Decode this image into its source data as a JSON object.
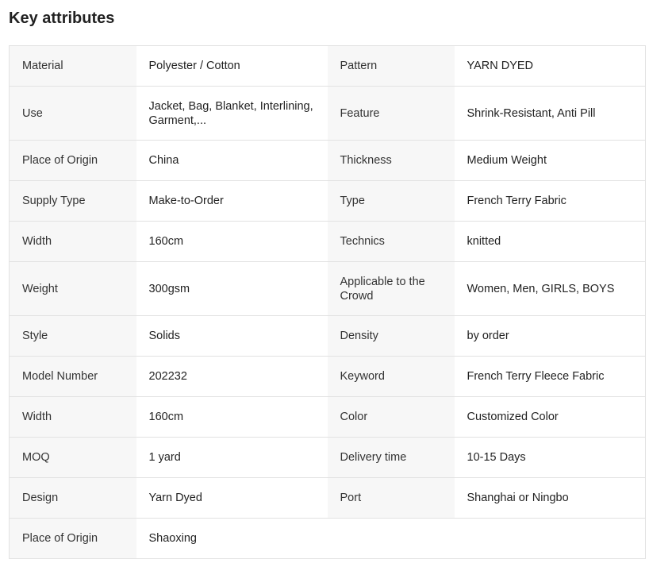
{
  "title": "Key attributes",
  "rows": [
    {
      "k1": "Material",
      "v1": "Polyester / Cotton",
      "k2": "Pattern",
      "v2": "YARN DYED"
    },
    {
      "k1": "Use",
      "v1": "Jacket, Bag, Blanket, Interlining, Garment,...",
      "k2": "Feature",
      "v2": "Shrink-Resistant, Anti Pill"
    },
    {
      "k1": "Place of Origin",
      "v1": "China",
      "k2": "Thickness",
      "v2": "Medium Weight"
    },
    {
      "k1": "Supply Type",
      "v1": "Make-to-Order",
      "k2": "Type",
      "v2": "French Terry Fabric"
    },
    {
      "k1": "Width",
      "v1": "160cm",
      "k2": "Technics",
      "v2": "knitted"
    },
    {
      "k1": "Weight",
      "v1": "300gsm",
      "k2": "Applicable to the Crowd",
      "v2": "Women, Men, GIRLS, BOYS"
    },
    {
      "k1": "Style",
      "v1": "Solids",
      "k2": "Density",
      "v2": "by order"
    },
    {
      "k1": "Model Number",
      "v1": "202232",
      "k2": "Keyword",
      "v2": "French Terry Fleece Fabric"
    },
    {
      "k1": "Width",
      "v1": "160cm",
      "k2": "Color",
      "v2": "Customized Color"
    },
    {
      "k1": "MOQ",
      "v1": "1 yard",
      "k2": "Delivery time",
      "v2": "10-15 Days"
    },
    {
      "k1": "Design",
      "v1": "Yarn Dyed",
      "k2": "Port",
      "v2": "Shanghai or Ningbo"
    },
    {
      "k1": "Place of Origin",
      "v1": "Shaoxing",
      "k2": "",
      "v2": ""
    }
  ]
}
